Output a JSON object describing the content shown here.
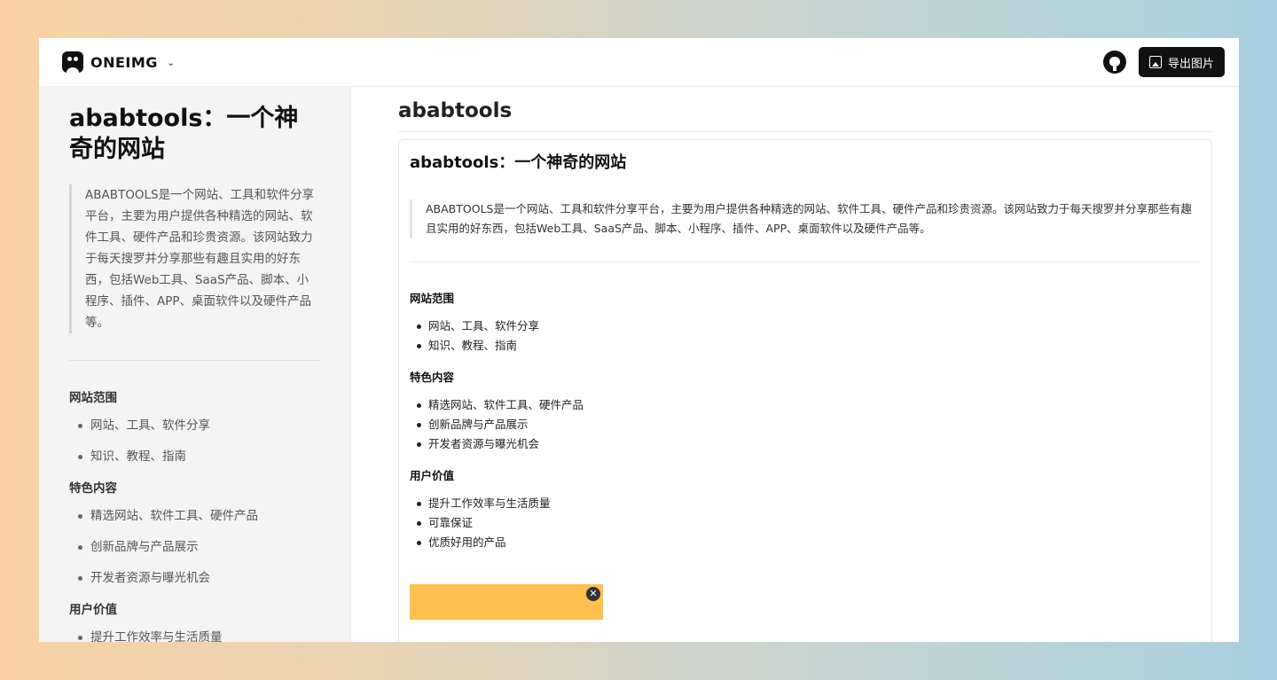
{
  "topbar": {
    "brand_name": "ONEIMG",
    "brand_chevron": "⌄",
    "export_label": "导出图片"
  },
  "article": {
    "title": "ababtools：一个神奇的网站",
    "intro": "ABABTOOLS是一个网站、工具和软件分享平台，主要为用户提供各种精选的网站、软件工具、硬件产品和珍贵资源。该网站致力于每天搜罗并分享那些有趣且实用的好东西，包括Web工具、SaaS产品、脚本、小程序、插件、APP、桌面软件以及硬件产品等。",
    "sections": [
      {
        "heading": "网站范围",
        "items": [
          "网站、工具、软件分享",
          "知识、教程、指南"
        ]
      },
      {
        "heading": "特色内容",
        "items": [
          "精选网站、软件工具、硬件产品",
          "创新品牌与产品展示",
          "开发者资源与曝光机会"
        ]
      },
      {
        "heading": "用户价值",
        "items": [
          "提升工作效率与生活质量",
          "可靠保证",
          "优质好用的产品"
        ]
      }
    ]
  },
  "main": {
    "page_title": "ababtools"
  },
  "ad": {
    "close_label": "✕"
  },
  "icons": {
    "brand": "oneimg-logo-icon",
    "github": "github-icon",
    "export": "image-icon",
    "close": "close-icon"
  }
}
